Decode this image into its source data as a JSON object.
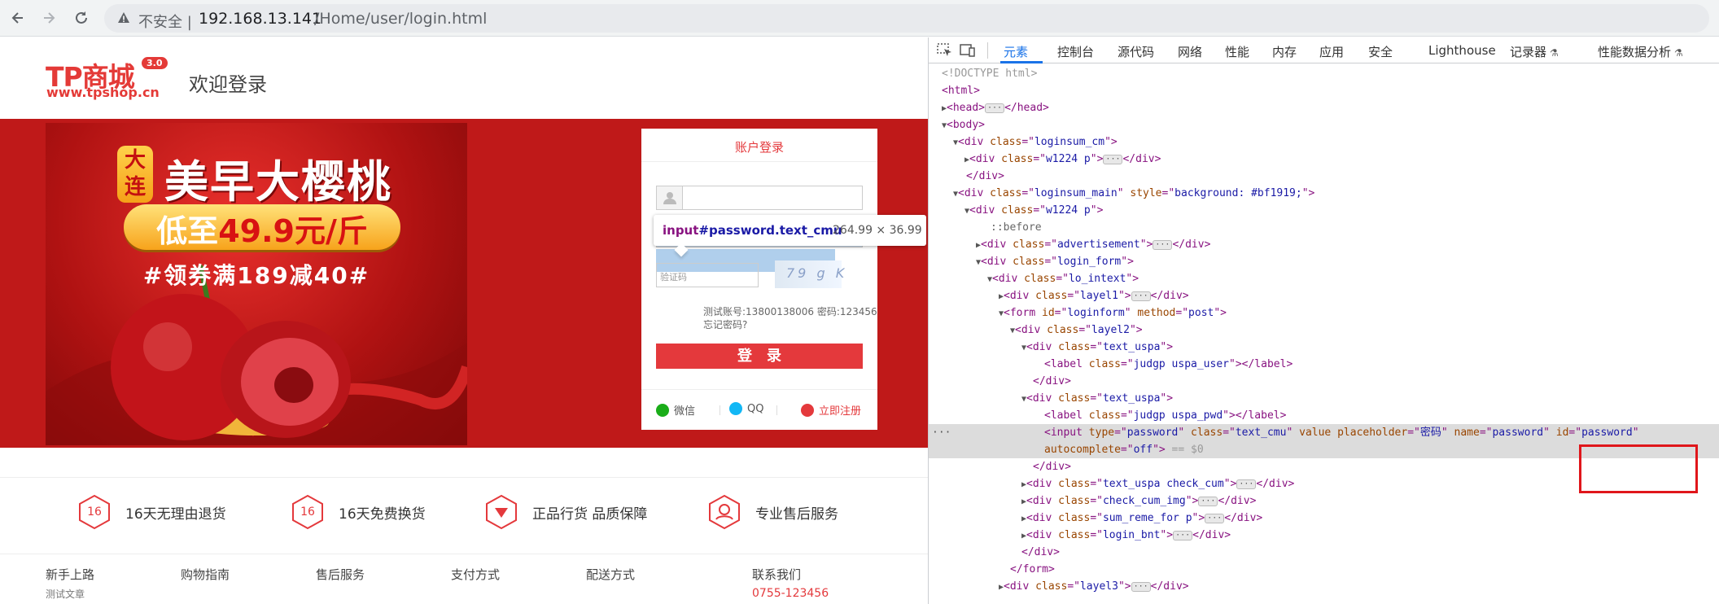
{
  "browser": {
    "back_icon": "arrow-left-icon",
    "forward_icon": "arrow-right-icon",
    "reload_icon": "reload-icon",
    "security_icon": "warning-triangle-icon",
    "security_label": "不安全",
    "url_host": "192.168.13.141",
    "url_path": "/Home/user/login.html"
  },
  "header": {
    "logo_text": "TP商城",
    "logo_version": "3.0",
    "logo_url": "www.tpshop.cn",
    "welcome": "欢迎登录"
  },
  "ad": {
    "city": "大连",
    "title": "美早大樱桃",
    "price_prefix": "低至",
    "price_value": "49.9元/斤",
    "coupon": "#领券满189减40#"
  },
  "login": {
    "title": "账户登录",
    "username_value": "",
    "password_value": "",
    "captcha_placeholder": "验证码",
    "captcha_image_text": "79 g K",
    "test_account": "测试账号:13800138006 密码:123456",
    "forgot": "忘记密码?",
    "submit": "登录",
    "wechat": "微信",
    "qq": "QQ",
    "register": "立即注册"
  },
  "tooltip": {
    "tag": "input",
    "selector": "#password.text_cmu",
    "size": "264.99 × 36.99"
  },
  "services": [
    {
      "num": "16",
      "label": "16天无理由退货",
      "icon": "return-badge-icon"
    },
    {
      "num": "16",
      "label": "16天免费换货",
      "icon": "exchange-badge-icon"
    },
    {
      "num": "",
      "label": "正品行货 品质保障",
      "icon": "diamond-icon"
    },
    {
      "num": "",
      "label": "专业售后服务",
      "icon": "support-agent-icon"
    }
  ],
  "footer": {
    "columns": [
      "新手上路",
      "购物指南",
      "售后服务",
      "支付方式",
      "配送方式",
      "联系我们"
    ],
    "sub_first": "测试文章",
    "phone": "0755-123456"
  },
  "devtools": {
    "tabs": [
      "元素",
      "控制台",
      "源代码",
      "网络",
      "性能",
      "内存",
      "应用",
      "安全",
      "Lighthouse",
      "记录器",
      "性能数据分析"
    ],
    "active_tab": "元素",
    "dom_lines": [
      "<!DOCTYPE html>",
      "<html>",
      "<head>",
      "</head>",
      "<body>",
      "loginsum_cm",
      "w1224 p",
      "loginsum_main",
      "background: #bf1919;",
      "::before",
      "advertisement",
      "login_form",
      "lo_intext",
      "layel1",
      "loginform",
      "post",
      "layel2",
      "text_uspa",
      "judgp uspa_user",
      "judgp uspa_pwd",
      "password",
      "text_cmu",
      "密码",
      "off",
      "== $0",
      "text_uspa check_cum",
      "check_cum_img",
      "sum_reme_for p",
      "login_bnt",
      "layel3"
    ]
  }
}
